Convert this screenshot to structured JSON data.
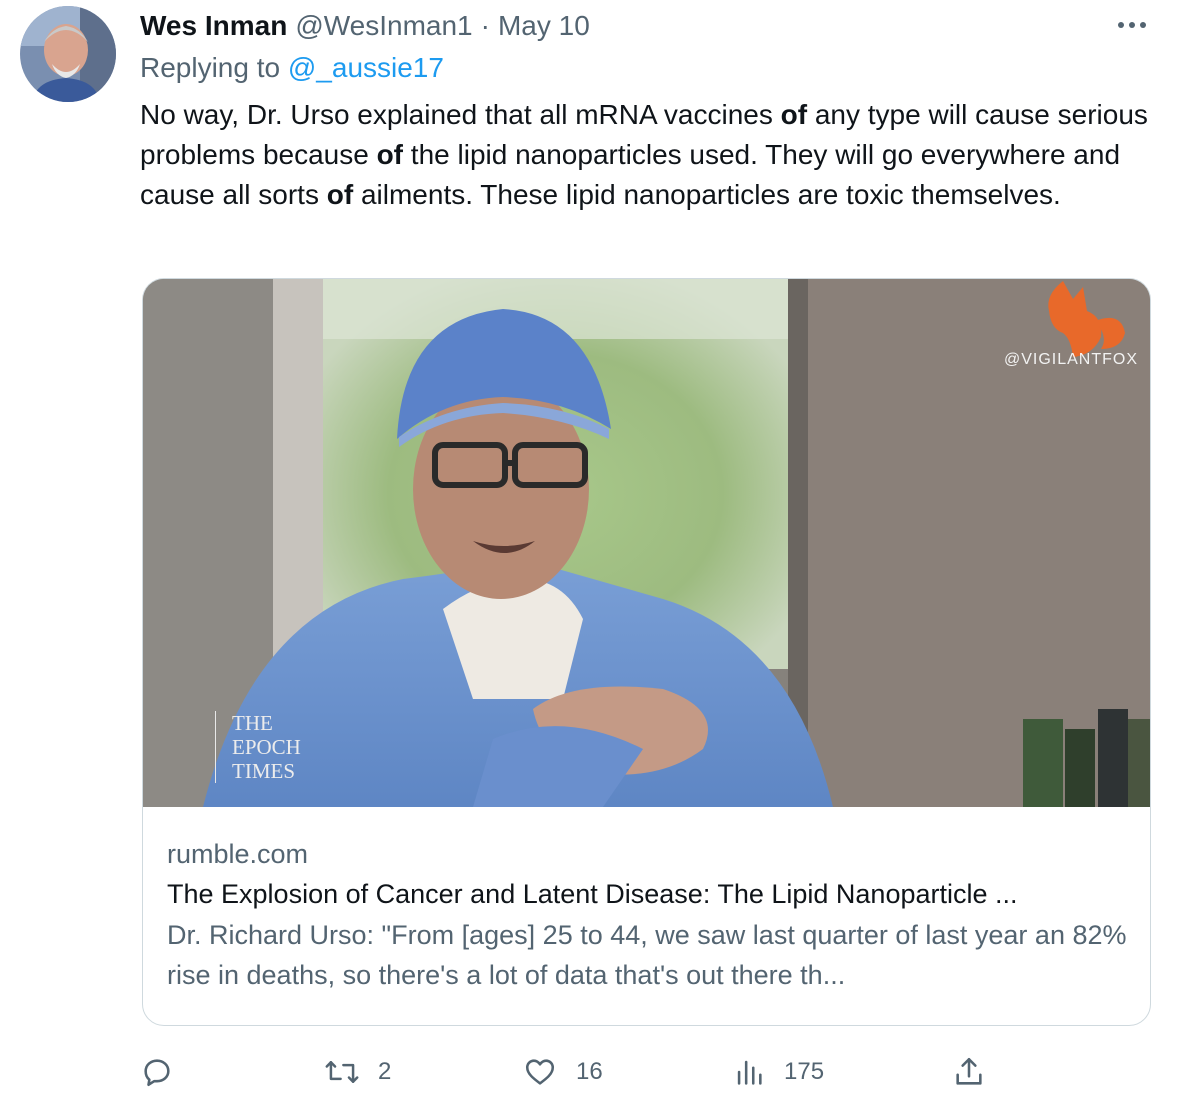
{
  "tweet": {
    "author_name": "Wes Inman",
    "author_handle": "@WesInman1",
    "separator": "·",
    "date": "May 10",
    "replying_prefix": "Replying to",
    "replying_handle": "@_aussie17",
    "text_segments": [
      {
        "t": "No way, Dr. Urso explained that all mRNA vaccines ",
        "bold": false
      },
      {
        "t": "of",
        "bold": true
      },
      {
        "t": " any type will cause serious problems because ",
        "bold": false
      },
      {
        "t": "of",
        "bold": true
      },
      {
        "t": " the lipid nanoparticles used. They will go everywhere and cause all sorts ",
        "bold": false
      },
      {
        "t": "of",
        "bold": true
      },
      {
        "t": " ailments. These lipid nanoparticles are toxic themselves.",
        "bold": false
      }
    ]
  },
  "card": {
    "watermark_handle": "@VIGILANTFOX",
    "epoch_logo_lines": [
      "THE",
      "EPOCH",
      "TIMES"
    ],
    "domain": "rumble.com",
    "title": "The Explosion of Cancer and Latent Disease: The Lipid Nanoparticle ...",
    "description": "Dr. Richard Urso: \"From [ages] 25 to 44, we saw last quarter of last year an 82% rise in deaths, so there's a lot of data that's out there th..."
  },
  "actions": {
    "reply_icon": "reply-icon",
    "retweet_icon": "retweet-icon",
    "retweet_count": "2",
    "like_icon": "heart-icon",
    "like_count": "16",
    "views_icon": "views-icon",
    "views_count": "175",
    "share_icon": "share-icon",
    "more_icon": "more-icon"
  },
  "colors": {
    "link": "#1d9bf0",
    "secondary_text": "#536471",
    "primary_text": "#0f1419",
    "border": "#cfd9de",
    "watermark_fox": "#e8692a"
  }
}
